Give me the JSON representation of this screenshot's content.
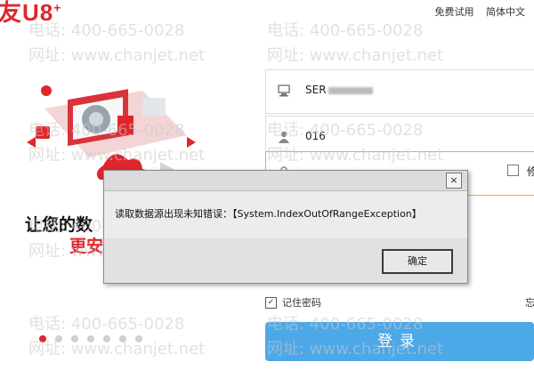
{
  "header": {
    "logo_text": "友U8",
    "logo_sup": "+",
    "free_trial": "免费试用",
    "language": "简体中文"
  },
  "watermark": {
    "phone": "电话: 400-665-0028",
    "website": "网址: www.chanjet.net"
  },
  "hero": {
    "slogan_line1": "让您的数",
    "slogan_line2": "更安"
  },
  "carousel": {
    "count": 7,
    "active_index": 0
  },
  "form": {
    "server_value": "SER",
    "user_value": "016",
    "right_char": "修",
    "remember_label": "记住密码",
    "remember_checked": "✓",
    "forget_label": "忘",
    "login_label": "登录"
  },
  "dialog": {
    "close_label": "×",
    "message": "读取数据源出现未知错误：【System.IndexOutOfRangeException】",
    "ok_label": "确定"
  },
  "colors": {
    "brand_red": "#e0262d",
    "login_blue": "#4da8e8",
    "input_focus": "#f0a63a"
  },
  "icons": [
    "server-icon",
    "user-icon",
    "lock-icon",
    "close-icon",
    "check-icon"
  ]
}
